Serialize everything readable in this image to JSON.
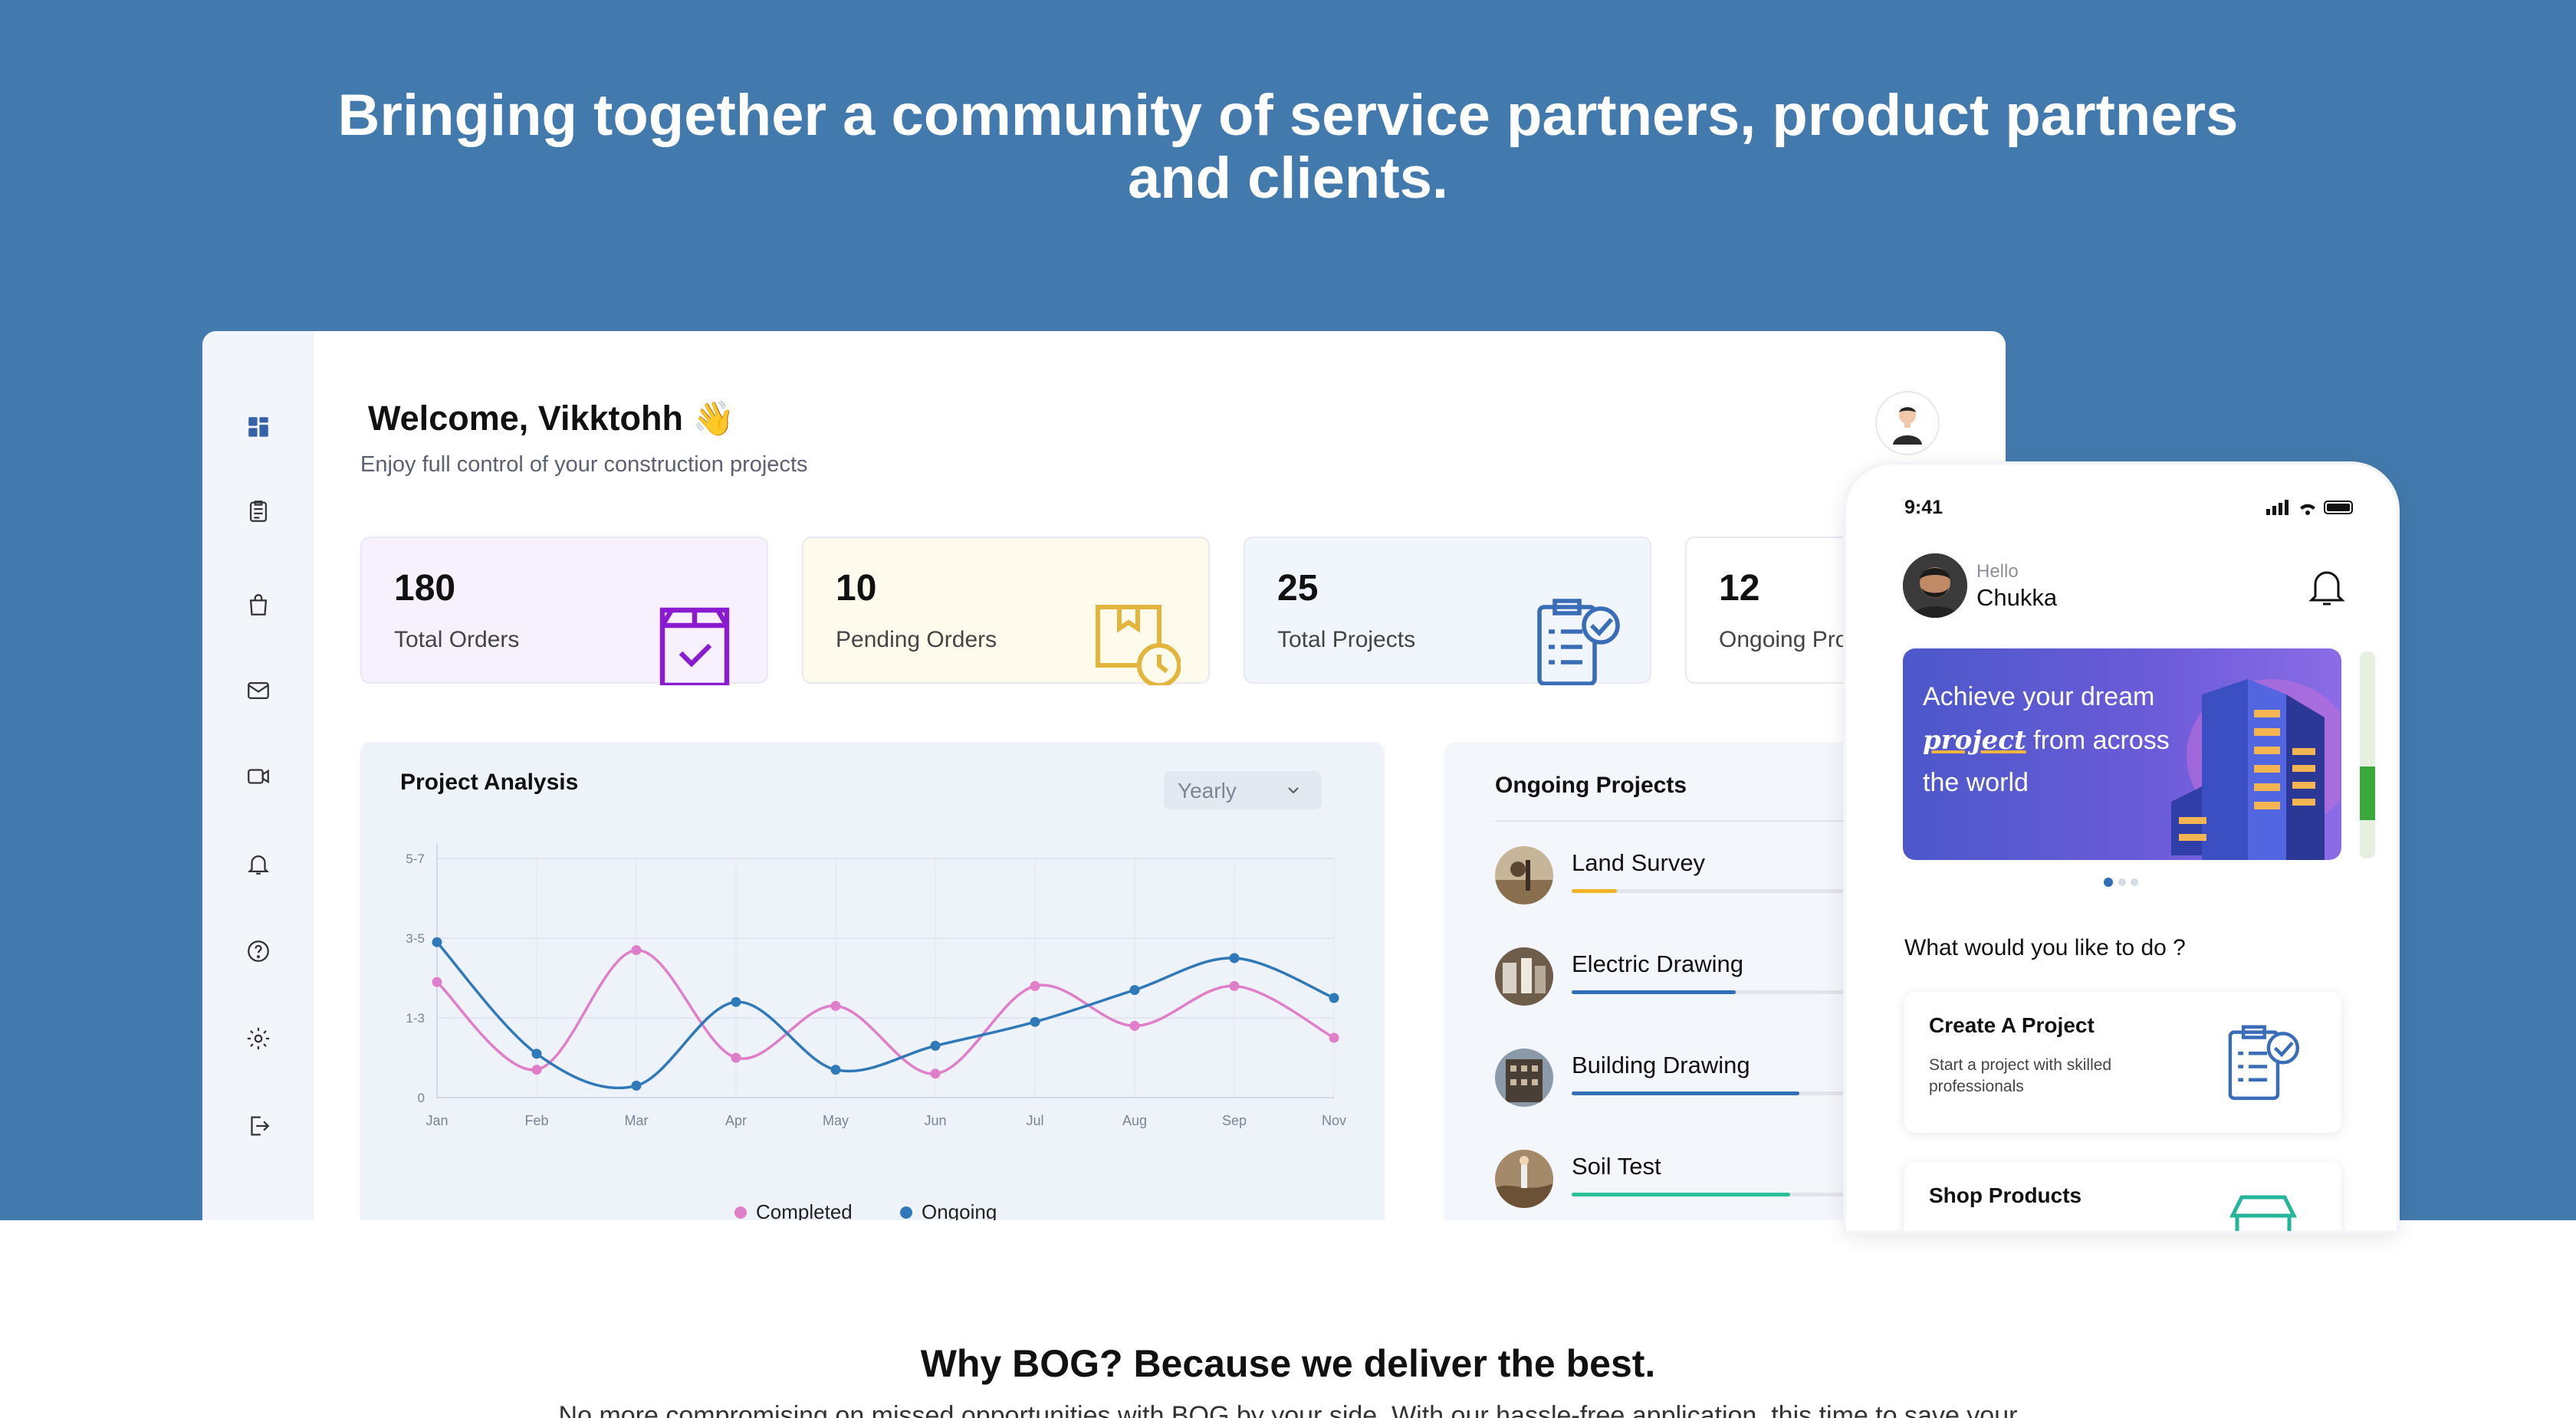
{
  "hero": {
    "title": "Bringing together a community of service partners, product partners and clients."
  },
  "sidebar": {
    "icons": [
      "dashboard-icon",
      "orders-icon",
      "bag-icon",
      "mail-icon",
      "video-icon",
      "bell-icon",
      "help-icon",
      "settings-icon",
      "logout-icon"
    ]
  },
  "dashboard": {
    "welcome": "Welcome, Vikktohh",
    "wave": "👋",
    "subtitle": "Enjoy full control of your construction projects",
    "stats": [
      {
        "value": "180",
        "label": "Total Orders",
        "bg": "#f7f1fd",
        "icon": "package-check-icon",
        "color": "#8a1bd1"
      },
      {
        "value": "10",
        "label": "Pending Orders",
        "bg": "#fffbec",
        "icon": "box-clock-icon",
        "color": "#e3b53c"
      },
      {
        "value": "25",
        "label": "Total Projects",
        "bg": "#f1f5fc",
        "icon": "clipboard-check-icon",
        "color": "#3a6db8"
      },
      {
        "value": "12",
        "label": "Ongoing Projects",
        "bg": "#ffffff",
        "icon": "ongoing-icon",
        "color": "#3a6db8"
      }
    ]
  },
  "analysis": {
    "title": "Project Analysis",
    "period": "Yearly"
  },
  "chart_data": {
    "type": "line",
    "categories": [
      "Jan",
      "Feb",
      "Mar",
      "Apr",
      "May",
      "Jun",
      "Jul",
      "Aug",
      "Sep",
      "Nov"
    ],
    "y_ticks": [
      "0",
      "1-3",
      "3-5",
      "5-7"
    ],
    "ylim": [
      0,
      6
    ],
    "series": [
      {
        "name": "Completed",
        "color": "#e07fc9",
        "values": [
          2.9,
          0.7,
          3.7,
          1.0,
          2.3,
          0.6,
          2.8,
          1.8,
          2.8,
          1.5
        ]
      },
      {
        "name": "Ongoing",
        "color": "#2f79b9",
        "values": [
          3.9,
          1.1,
          0.3,
          2.4,
          0.7,
          1.3,
          1.9,
          2.7,
          3.5,
          2.5
        ]
      }
    ],
    "legend": "bottom-center",
    "grid": true
  },
  "ongoing": {
    "title": "Ongoing Projects",
    "items": [
      {
        "name": "Land Survey",
        "progress": 0.05,
        "color": "#f0b428"
      },
      {
        "name": "Electric Drawing",
        "progress": 0.18,
        "color": "#2f6fb6"
      },
      {
        "name": "Building Drawing",
        "progress": 0.25,
        "color": "#2f6fb6"
      },
      {
        "name": "Soil Test",
        "progress": 0.24,
        "color": "#2bbf9a"
      }
    ]
  },
  "phone": {
    "time": "9:41",
    "hello": "Hello",
    "name": "Chukka",
    "banner": {
      "line1": "Achieve your dream",
      "script": "project",
      "line2": " from across",
      "line3": "the world"
    },
    "question": "What would you like to do ?",
    "cards": [
      {
        "title": "Create A Project",
        "subtitle": "Start a project with skilled professionals"
      },
      {
        "title": "Shop Products",
        "subtitle": ""
      }
    ]
  },
  "why": {
    "title": "Why BOG? Because we deliver the best.",
    "subtitle": "No more compromising on missed opportunities with BOG by your side. With our hassle-free application, this time to save your"
  }
}
